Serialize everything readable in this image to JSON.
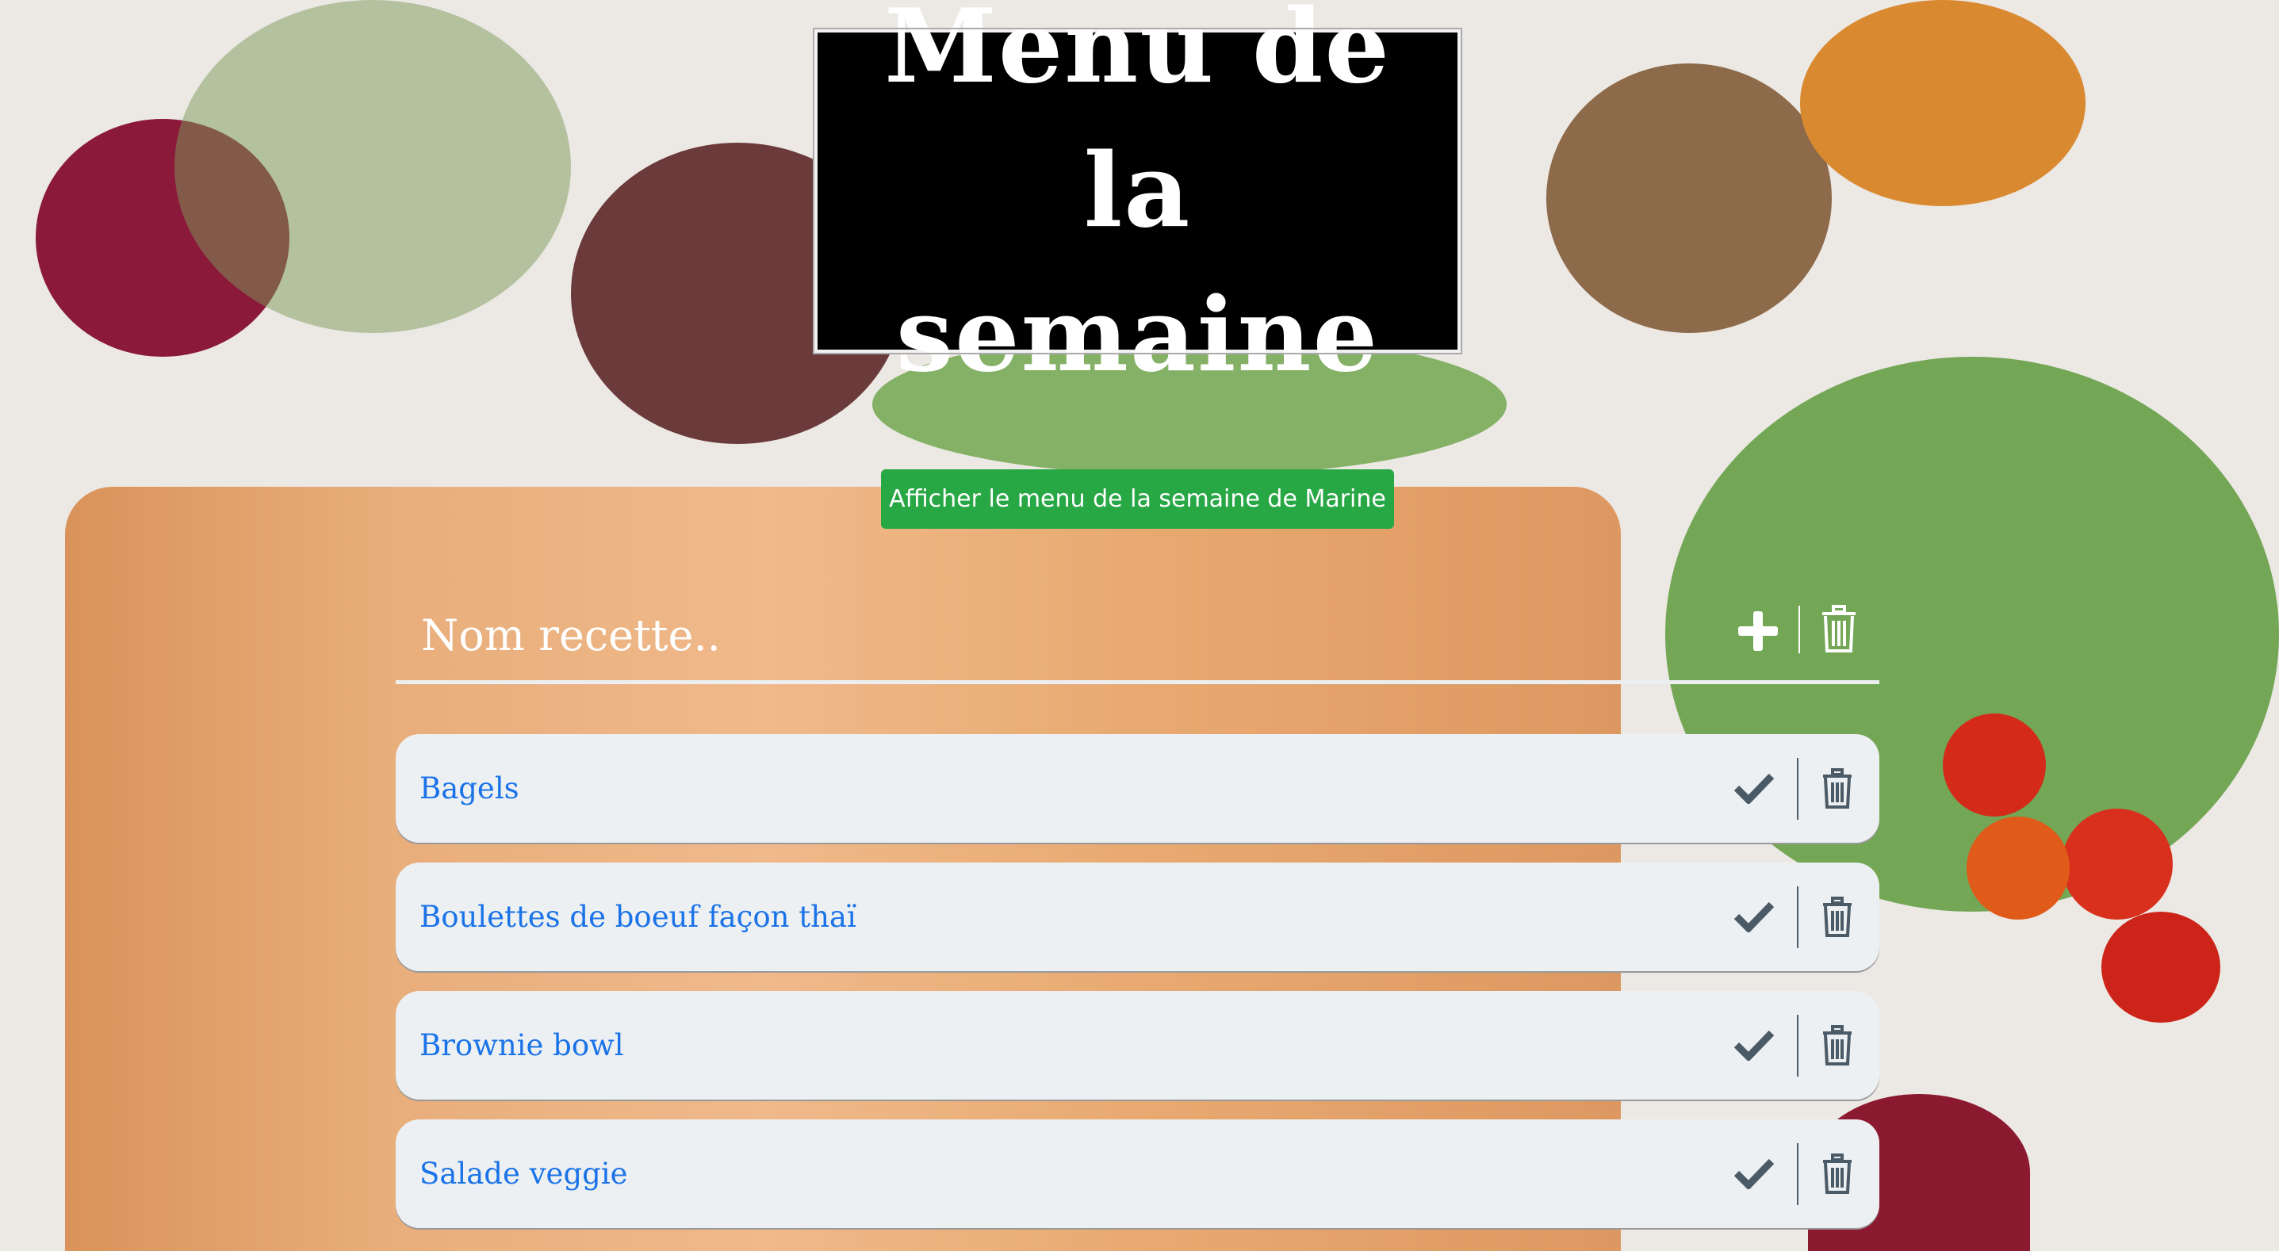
{
  "header": {
    "title_line1": "Menu de la",
    "title_line2": "semaine"
  },
  "show_button": {
    "label": "Afficher le menu de la semaine de Marine"
  },
  "recipe_input": {
    "value": "",
    "placeholder": "Nom recette.."
  },
  "recipes": [
    {
      "name": "Bagels"
    },
    {
      "name": "Boulettes de boeuf façon thaï"
    },
    {
      "name": "Brownie bowl"
    },
    {
      "name": "Salade veggie"
    }
  ],
  "colors": {
    "accent_green": "#28a745",
    "item_text": "#1a73e8",
    "item_bg": "#edf0f3",
    "icon": "#4a5a66"
  }
}
